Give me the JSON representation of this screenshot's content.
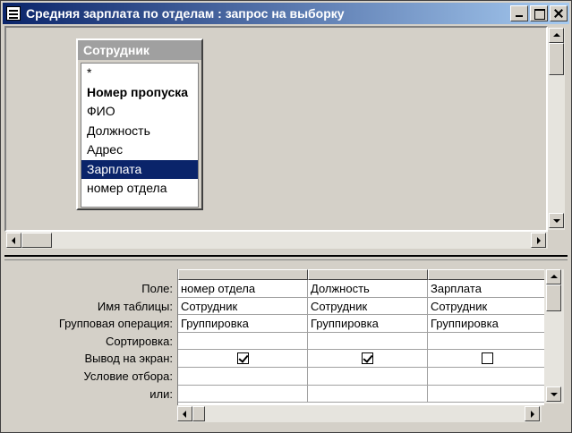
{
  "window": {
    "title": "Средняя зарплата по отделам : запрос на выборку"
  },
  "field_list": {
    "title": "Сотрудник",
    "items": [
      {
        "label": "*",
        "bold": false,
        "selected": false
      },
      {
        "label": "Номер пропуска",
        "bold": true,
        "selected": false
      },
      {
        "label": "ФИО",
        "bold": false,
        "selected": false
      },
      {
        "label": "Должность",
        "bold": false,
        "selected": false
      },
      {
        "label": "Адрес",
        "bold": false,
        "selected": false
      },
      {
        "label": "Зарплата",
        "bold": false,
        "selected": true
      },
      {
        "label": "номер отдела",
        "bold": false,
        "selected": false
      }
    ]
  },
  "grid": {
    "row_labels": [
      "Поле:",
      "Имя таблицы:",
      "Групповая операция:",
      "Сортировка:",
      "Вывод на экран:",
      "Условие отбора:",
      "или:"
    ],
    "columns": [
      {
        "field": "номер отдела",
        "table": "Сотрудник",
        "group": "Группировка",
        "sort": "",
        "show": true,
        "criteria": "",
        "or": ""
      },
      {
        "field": "Должность",
        "table": "Сотрудник",
        "group": "Группировка",
        "sort": "",
        "show": true,
        "criteria": "",
        "or": ""
      },
      {
        "field": "Зарплата",
        "table": "Сотрудник",
        "group": "Группировка",
        "sort": "",
        "show": false,
        "criteria": "",
        "or": ""
      }
    ]
  },
  "colors": {
    "title_bar_start": "#0a246a",
    "title_bar_end": "#a6caf0",
    "selection": "#0a246a",
    "face": "#d4d0c8"
  }
}
